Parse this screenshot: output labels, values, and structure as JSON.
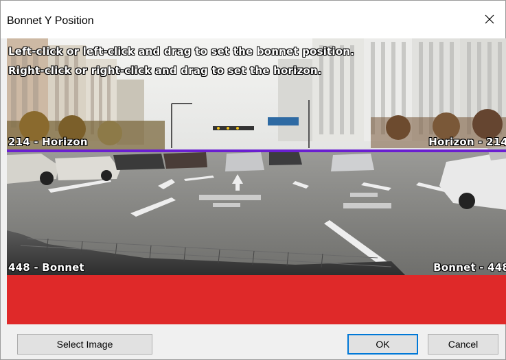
{
  "window": {
    "title": "Bonnet Y Position",
    "close_glyph": "×"
  },
  "viewport": {
    "instruction_line_1": "Left-click or left-click and drag to set the bonnet position.",
    "instruction_line_2": "Right-click or right-click and drag to set the horizon.",
    "horizon": {
      "value": 214,
      "label_left": "214 - Horizon",
      "label_right": "Horizon - 214",
      "color": "#6a1fd1"
    },
    "bonnet": {
      "value": 448,
      "label_left": "448 - Bonnet",
      "label_right": "Bonnet - 448",
      "color": "#e12323"
    }
  },
  "buttons": {
    "select_image": "Select Image",
    "ok": "OK",
    "cancel": "Cancel"
  }
}
